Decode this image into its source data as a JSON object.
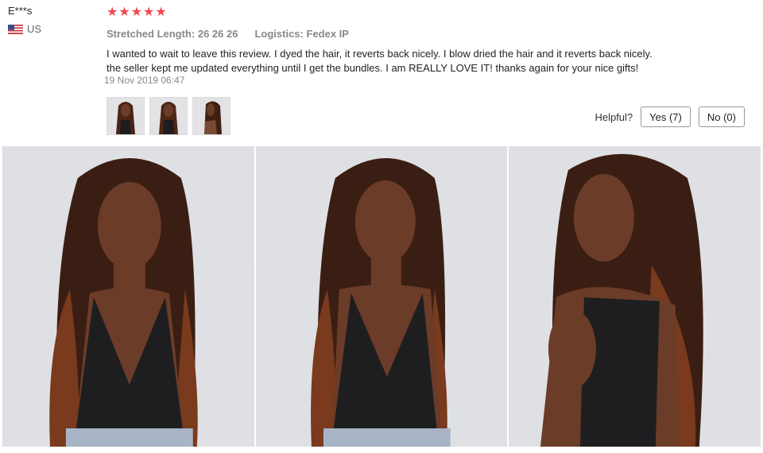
{
  "reviewer": {
    "name": "E***s",
    "country": "US",
    "flag_icon": "us-flag-icon"
  },
  "review": {
    "rating": 5,
    "star_color": "#f0494f",
    "stretched_length_label": "Stretched Length:",
    "stretched_length_value": "26 26 26",
    "logistics_label": "Logistics:",
    "logistics_value": "Fedex IP",
    "line1": "I wanted to wait to leave this review. I dyed the hair, it reverts back nicely. I blow dried the hair and it reverts back nicely.",
    "line2": "the seller kept me updated everything until I get the bundles. I am REALLY LOVE IT! thanks again for your nice gifts!",
    "date": "19 Nov 2019 06:47"
  },
  "helpful": {
    "label": "Helpful?",
    "yes_label": "Yes (7)",
    "no_label": "No (0)"
  },
  "thumbnails": [
    "photo-1",
    "photo-2",
    "photo-3"
  ],
  "photos": [
    "photo-front",
    "photo-front-2",
    "photo-side"
  ]
}
